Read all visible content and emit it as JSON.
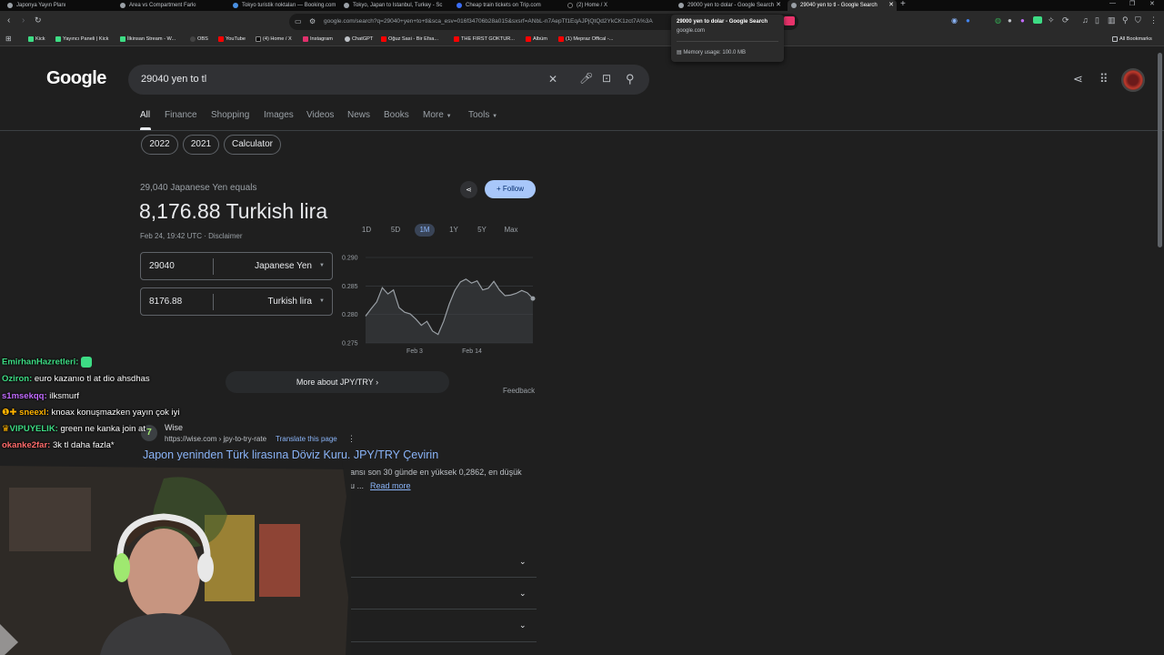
{
  "browser": {
    "tabs": [
      {
        "title": "Japonya Yayın Planı",
        "active": false
      },
      {
        "title": "Area vs Compartment Farkı",
        "active": false
      },
      {
        "title": "Tokyo turistik noktaları — Booking.com",
        "active": false
      },
      {
        "title": "Tokyo, Japan to Istanbul, Turkey - Sc",
        "active": false
      },
      {
        "title": "Cheap train tickets on Trip.com",
        "active": false
      },
      {
        "title": "(2) Home / X",
        "active": false
      },
      {
        "title": "29000 yen to dolar - Google Search",
        "active": false
      },
      {
        "title": "29040 yen to tl - Google Search",
        "active": true
      }
    ],
    "url": "google.com/search?q=29040+yen+to+tl&sca_esv=016f34706b28a015&sxsrf=ANbL-n7AepTf1EqAJPjQtQd2YkCK1zct7A%3A",
    "bookmarks": [
      "Kick",
      "Yayıncı Paneli | Kick",
      "İlkinsan Stream - W...",
      "OBS",
      "YouTube",
      "(4) Home / X",
      "Instagram",
      "ChatGPT",
      "Oğuz Sasi - Bir Efsa...",
      "THE FIRST GOKTUR...",
      "Albüm",
      "(1) Mepraz Offical -..."
    ],
    "all_bookmarks": "All Bookmarks",
    "tooltip": {
      "title": "29000 yen to dolar - Google Search",
      "domain": "google.com",
      "memory": "Memory usage: 100.0 MB"
    }
  },
  "google": {
    "logo": "Google",
    "query": "29040 yen to tl",
    "nav_tabs": [
      "All",
      "Finance",
      "Shopping",
      "Images",
      "Videos",
      "News",
      "Books",
      "More",
      "Tools"
    ],
    "chips": [
      "2022",
      "2021",
      "Calculator"
    ]
  },
  "converter": {
    "equals_label": "29,040 Japanese Yen equals",
    "result": "8,176.88 Turkish lira",
    "timestamp": "Feb 24, 19:42 UTC · Disclaimer",
    "from_value": "29040",
    "from_currency": "Japanese Yen",
    "to_value": "8176.88",
    "to_currency": "Turkish lira",
    "follow": "Follow",
    "ranges": [
      "1D",
      "5D",
      "1M",
      "1Y",
      "5Y",
      "Max"
    ],
    "active_range": "1M",
    "more_about": "More about JPY/TRY",
    "feedback": "Feedback"
  },
  "chart_data": {
    "type": "line",
    "title": "",
    "xlabel": "",
    "ylabel": "",
    "ylim": [
      0.275,
      0.29
    ],
    "y_ticks": [
      "0.290",
      "0.285",
      "0.280",
      "0.275"
    ],
    "x_ticks": [
      "Feb 3",
      "Feb 14"
    ],
    "x": [
      0,
      1,
      2,
      3,
      4,
      5,
      6,
      7,
      8,
      9,
      10,
      11,
      12,
      13,
      14,
      15,
      16,
      17,
      18,
      19,
      20,
      21,
      22,
      23,
      24,
      25,
      26,
      27,
      28,
      29,
      30
    ],
    "values": [
      0.2797,
      0.281,
      0.2822,
      0.2847,
      0.2836,
      0.2843,
      0.2812,
      0.2804,
      0.2801,
      0.2792,
      0.2781,
      0.2788,
      0.2771,
      0.2765,
      0.2788,
      0.2818,
      0.2842,
      0.2857,
      0.2862,
      0.2855,
      0.2859,
      0.2843,
      0.2846,
      0.2858,
      0.2843,
      0.2833,
      0.2834,
      0.2837,
      0.2842,
      0.2838,
      0.2828
    ],
    "color": "#9aa0a6",
    "grid": true
  },
  "result": {
    "site_name": "Wise",
    "site_url": "https://wise.com › jpy-to-try-rate",
    "translate": "Translate this page",
    "title": "Japon yeninden Türk lirasına Döviz Kuru. JPY/TRY Çevirin",
    "snippet_1": "ansı son 30 günde en yüksek 0,2862, en düşük",
    "snippet_2": "u ...",
    "read_more": "Read more"
  },
  "chat": [
    {
      "user": "EmirhanHazretleri:",
      "color": "#3ddc84",
      "msg": "",
      "badge": ""
    },
    {
      "user": "Oziron:",
      "color": "#3ddc84",
      "msg": "euro kazanıo tl at dio ahsdhas",
      "badge": ""
    },
    {
      "user": "s1msekqq:",
      "color": "#c26bff",
      "msg": "ilksmurf",
      "badge": ""
    },
    {
      "user": "sneexl:",
      "color": "#ffb300",
      "msg": "knoax konuşmazken yayın çok iyi",
      "badge": "❶✚"
    },
    {
      "user": "VIPUYELIK:",
      "color": "#3ddc84",
      "msg": "green ne kanka join at",
      "badge": "♛"
    },
    {
      "user": "okanke2far:",
      "color": "#ff6b6b",
      "msg": "3k tl daha fazla*",
      "badge": ""
    }
  ]
}
